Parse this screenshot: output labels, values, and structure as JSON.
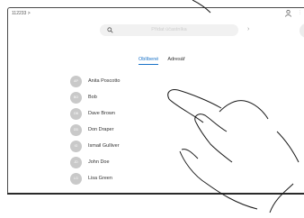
{
  "breadcrumb": "112233 >",
  "search": {
    "placeholder": "Přidat účastníka"
  },
  "tabs": [
    {
      "label": "Oblíbené",
      "active": true
    },
    {
      "label": "Adresář",
      "active": false
    }
  ],
  "contacts": [
    {
      "initials": "AP",
      "name": "Anita Poscotto"
    },
    {
      "initials": "BO",
      "name": "Bob"
    },
    {
      "initials": "DB",
      "name": "Dave Brown"
    },
    {
      "initials": "DD",
      "name": "Don Draper"
    },
    {
      "initials": "IG",
      "name": "Ismail Gulliver"
    },
    {
      "initials": "JD",
      "name": "John Doe"
    },
    {
      "initials": "LG",
      "name": "Lisa Green"
    }
  ],
  "colors": {
    "accent": "#1a73c8",
    "avatar": "#c9c9c9",
    "frame": "#4a4a4a"
  },
  "icons": [
    "search-icon",
    "user-icon",
    "chevron-right-icon",
    "hand-gesture-icon"
  ]
}
